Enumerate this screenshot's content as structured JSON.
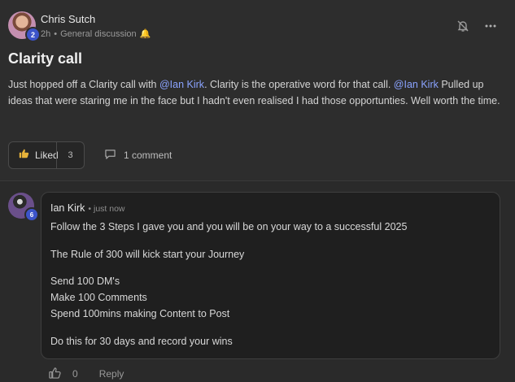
{
  "post": {
    "author": "Chris Sutch",
    "level": "2",
    "time": "2h",
    "separator": "•",
    "category": "General discussion",
    "category_emoji": "🔔",
    "title": "Clarity call",
    "body": {
      "p1": "Just hopped off a Clarity call with ",
      "m1": "@Ian Kirk",
      "p2": ". Clarity is the operative word for that call. ",
      "m2": "@Ian Kirk",
      "p3": " Pulled up ideas that were staring me in the face but I hadn't even realised I had those opportunties. Well worth the time."
    },
    "like_label": "Liked",
    "like_count": "3",
    "comments_label": "1 comment"
  },
  "comment": {
    "author": "Ian Kirk",
    "level": "6",
    "time": "• just now",
    "lines": [
      "Follow the 3 Steps I gave you and you will be on your way to a successful 2025",
      "The Rule of 300 will kick start your Journey",
      "Send 100 DM's",
      "Make 100 Comments",
      "Spend 100mins making Content to Post",
      "Do this for 30 days and record your wins"
    ],
    "like_count": "0",
    "reply_label": "Reply"
  },
  "colors": {
    "accent_mention": "#8aa3ff",
    "level_badge": "#3c54c9",
    "like_icon": "#e8b43a"
  }
}
